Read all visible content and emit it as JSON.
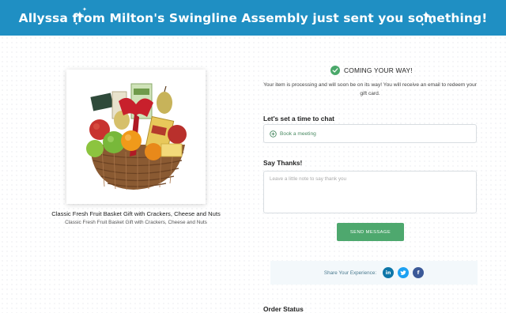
{
  "banner": {
    "title": "Allyssa from Milton's Swingline Assembly just sent you something!",
    "background": "#1f8fc3"
  },
  "product": {
    "title": "Classic Fresh Fruit Basket Gift with Crackers, Cheese and Nuts",
    "subtitle": "Classic Fresh Fruit Basket Gift with Crackers, Cheese and Nuts"
  },
  "status": {
    "heading": "COMING YOUR WAY!",
    "message": "Your item is processing and will soon be on its way! You will receive an email to redeem your gift card.",
    "icon": "check-circle-icon",
    "accent": "#4aa86a"
  },
  "chat": {
    "label": "Let's set a time to chat",
    "book_label": "Book a meeting",
    "book_icon": "plus-circle-icon"
  },
  "thanks": {
    "label": "Say Thanks!",
    "placeholder": "Leave a little note to say thank you",
    "send_label": "SEND MESSAGE",
    "button_color": "#4ea86e"
  },
  "share": {
    "label": "Share Your Experience:",
    "networks": [
      {
        "name": "linkedin",
        "glyph": "in",
        "color": "#0e76a8"
      },
      {
        "name": "twitter",
        "glyph": "t",
        "color": "#1da1f2"
      },
      {
        "name": "facebook",
        "glyph": "f",
        "color": "#3b5998"
      }
    ]
  },
  "order": {
    "label": "Order Status"
  }
}
